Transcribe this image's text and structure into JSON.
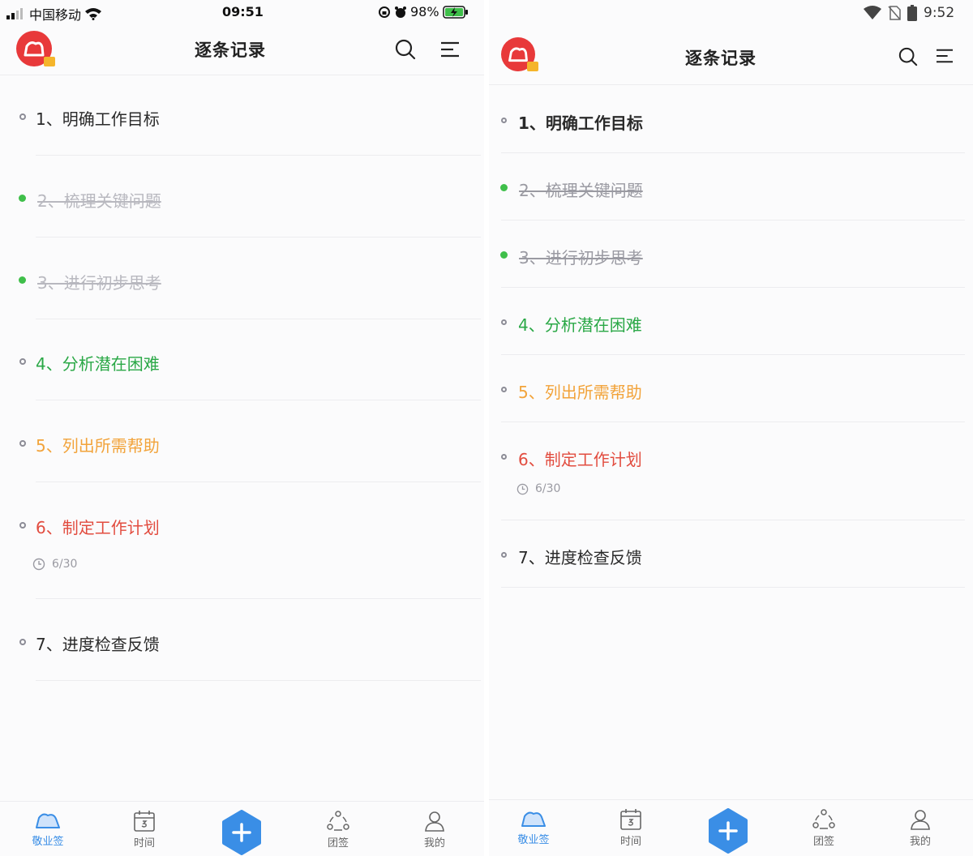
{
  "colors": {
    "logo_red": "#e8393a",
    "accent_blue": "#3a8ee6",
    "done_green": "#3fbf4a",
    "item_green": "#2aa846",
    "item_orange": "#f2a33a",
    "item_red": "#e24c3f"
  },
  "left": {
    "status": {
      "carrier": "中国移动",
      "time": "09:51",
      "battery": "98%"
    },
    "title": "逐条记录",
    "items": [
      {
        "text": "1、明确工作目标",
        "color": "black",
        "done": false
      },
      {
        "text": "2、梳理关键问题",
        "color": "gray",
        "done": true
      },
      {
        "text": "3、进行初步思考",
        "color": "gray",
        "done": true
      },
      {
        "text": "4、分析潜在困难",
        "color": "green",
        "done": false
      },
      {
        "text": "5、列出所需帮助",
        "color": "orange",
        "done": false
      },
      {
        "text": "6、制定工作计划",
        "color": "red",
        "done": false,
        "due": "6/30"
      },
      {
        "text": "7、进度检查反馈",
        "color": "black",
        "done": false
      }
    ],
    "tabs": [
      {
        "label": "敬业签",
        "icon": "cloud-icon",
        "active": true
      },
      {
        "label": "时间",
        "icon": "calendar-icon",
        "active": false
      },
      {
        "label": "团签",
        "icon": "team-icon",
        "active": false
      },
      {
        "label": "我的",
        "icon": "user-icon",
        "active": false
      }
    ]
  },
  "right": {
    "status": {
      "time": "9:52"
    },
    "title": "逐条记录",
    "items": [
      {
        "text": "1、明确工作目标",
        "color": "black",
        "done": false
      },
      {
        "text": "2、梳理关键问题",
        "color": "gray",
        "done": true
      },
      {
        "text": "3、进行初步思考",
        "color": "gray",
        "done": true
      },
      {
        "text": "4、分析潜在困难",
        "color": "green",
        "done": false
      },
      {
        "text": "5、列出所需帮助",
        "color": "orange",
        "done": false
      },
      {
        "text": "6、制定工作计划",
        "color": "red",
        "done": false,
        "due": "6/30"
      },
      {
        "text": "7、进度检查反馈",
        "color": "black",
        "done": false
      }
    ],
    "tabs": [
      {
        "label": "敬业签",
        "icon": "cloud-icon",
        "active": true
      },
      {
        "label": "时间",
        "icon": "calendar-icon",
        "active": false
      },
      {
        "label": "团签",
        "icon": "team-icon",
        "active": false
      },
      {
        "label": "我的",
        "icon": "user-icon",
        "active": false
      }
    ]
  }
}
